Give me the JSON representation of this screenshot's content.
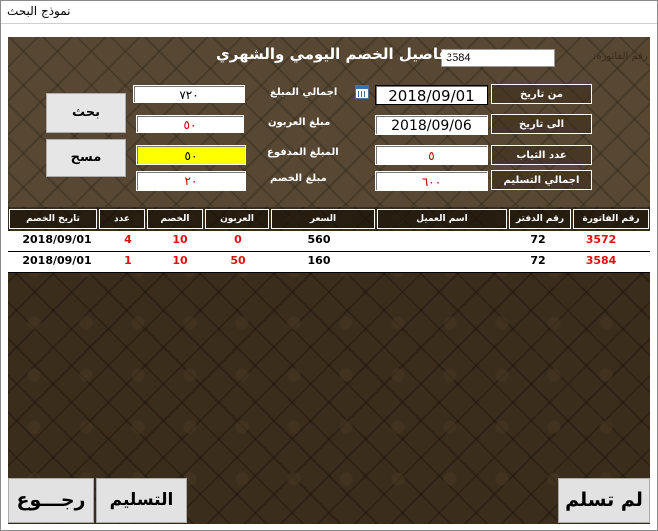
{
  "window": {
    "title": "نموذج البحث"
  },
  "header": {
    "invoice_label": "رقم الفاتورة:",
    "invoice_value": "3584",
    "heading": "تفاصيل الخصم اليومي والشهري"
  },
  "summary": {
    "total_amount_label": "اجمالي المبلغ",
    "total_amount": "٧٢٠",
    "deposit_label": "مبلغ العربون",
    "deposit": "٥٠",
    "paid_label": "المبلغ المدفوع",
    "paid": "٥٠",
    "discount_label": "مبلغ الخصم",
    "discount": "٢٠"
  },
  "filters": {
    "from_label": "من تاريخ",
    "from_date": "2018/09/01",
    "to_label": "الى تاريخ",
    "to_date": "2018/09/06",
    "clothes_label": "عدد الثياب",
    "clothes_count": "٥",
    "delivery_label": "اجمالي التسليم",
    "delivery_total": "٦٠٠"
  },
  "buttons": {
    "search": "بحث",
    "clear": "مسح",
    "back": "رجـــوع",
    "delivered": "التسليم",
    "not_delivered": "لم تسلم"
  },
  "grid": {
    "columns": {
      "discount_date": "تاريخ الخصم",
      "clothes_count": "عدد الثياب",
      "discount": "الخصم",
      "deposit": "العربون",
      "price": "السعر",
      "customer": "اسم العميل",
      "book_no": "رقم الدفتر",
      "invoice_no": "رقم الفاتورة"
    },
    "rows": [
      {
        "discount_date": "2018/09/01",
        "clothes_count": "4",
        "discount": "10",
        "deposit": "0",
        "price": "560",
        "customer": "",
        "book_no": "72",
        "invoice_no": "3572"
      },
      {
        "discount_date": "2018/09/01",
        "clothes_count": "1",
        "discount": "10",
        "deposit": "50",
        "price": "160",
        "customer": "",
        "book_no": "72",
        "invoice_no": "3584"
      }
    ]
  },
  "colors": {
    "highlight": "#ffff00",
    "accent_red": "#e01010",
    "background": "#3b2d1c"
  }
}
